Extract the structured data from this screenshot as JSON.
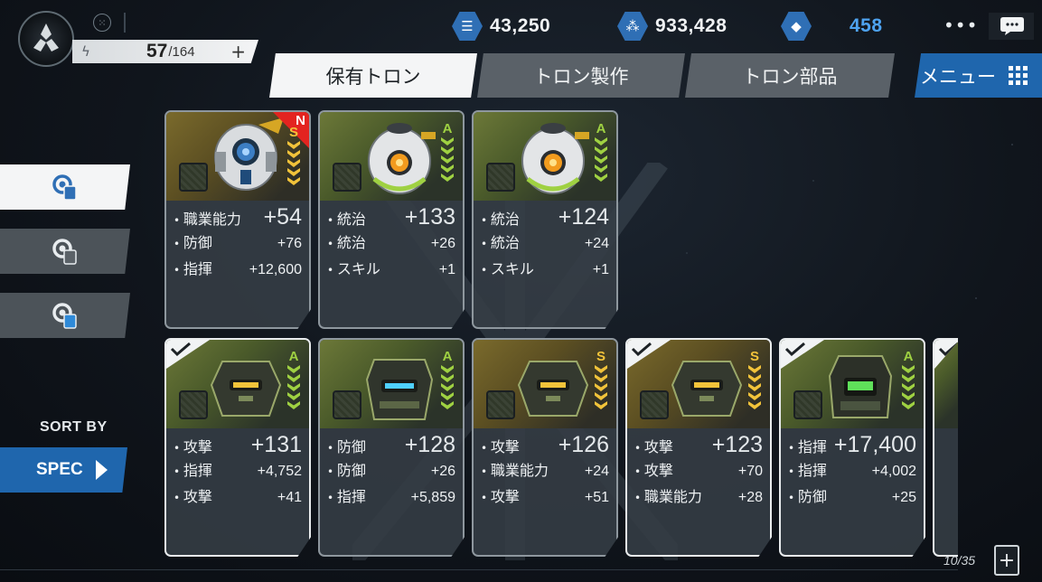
{
  "header": {
    "stamina_current": "57",
    "stamina_max": "/164",
    "stamina_plus": "+",
    "resources": [
      {
        "icon": "layers-icon",
        "value": "43,250",
        "color": "#2f6fb5"
      },
      {
        "icon": "molecule-icon",
        "value": "933,428",
        "color": "#2f6fb5"
      },
      {
        "icon": "crystal-icon",
        "value": "458",
        "color": "#4ea3f0"
      }
    ],
    "more_label": "•••"
  },
  "tabs": [
    {
      "label": "保有トロン",
      "active": true
    },
    {
      "label": "トロン製作",
      "active": false
    },
    {
      "label": "トロン部品",
      "active": false
    }
  ],
  "menu_label": "メニュー",
  "sidebar": {
    "filters": [
      {
        "icon": "tron-filter-all-icon",
        "active": true
      },
      {
        "icon": "tron-filter-gray-icon",
        "active": false
      },
      {
        "icon": "tron-filter-blue-icon",
        "active": false
      }
    ],
    "sort_by_label": "SORT BY",
    "sort_value": "SPEC"
  },
  "cards_row1": [
    {
      "rank": "S",
      "new_label": "N",
      "checked": false,
      "portrait": "white-gold",
      "stats": [
        {
          "name": "職業能力",
          "value": "+54"
        },
        {
          "name": "防御",
          "value": "+76"
        },
        {
          "name": "指揮",
          "value": "+12,600"
        }
      ]
    },
    {
      "rank": "A",
      "checked": false,
      "portrait": "white-green",
      "stats": [
        {
          "name": "統治",
          "value": "+133"
        },
        {
          "name": "統治",
          "value": "+26"
        },
        {
          "name": "スキル",
          "value": "+1"
        }
      ]
    },
    {
      "rank": "A",
      "checked": false,
      "portrait": "white-green",
      "stats": [
        {
          "name": "統治",
          "value": "+124"
        },
        {
          "name": "統治",
          "value": "+24"
        },
        {
          "name": "スキル",
          "value": "+1"
        }
      ]
    }
  ],
  "cards_row2": [
    {
      "rank": "A",
      "checked": true,
      "stats": [
        {
          "name": "攻撃",
          "value": "+131"
        },
        {
          "name": "指揮",
          "value": "+4,752"
        },
        {
          "name": "攻撃",
          "value": "+41"
        }
      ]
    },
    {
      "rank": "A",
      "checked": false,
      "stats": [
        {
          "name": "防御",
          "value": "+128"
        },
        {
          "name": "防御",
          "value": "+26"
        },
        {
          "name": "指揮",
          "value": "+5,859"
        }
      ]
    },
    {
      "rank": "S",
      "checked": false,
      "stats": [
        {
          "name": "攻撃",
          "value": "+126"
        },
        {
          "name": "職業能力",
          "value": "+24"
        },
        {
          "name": "攻撃",
          "value": "+51"
        }
      ]
    },
    {
      "rank": "S",
      "checked": true,
      "stats": [
        {
          "name": "攻撃",
          "value": "+123"
        },
        {
          "name": "攻撃",
          "value": "+70"
        },
        {
          "name": "職業能力",
          "value": "+28"
        }
      ]
    },
    {
      "rank": "A",
      "checked": true,
      "stats": [
        {
          "name": "指揮",
          "value": "+17,400"
        },
        {
          "name": "指揮",
          "value": "+4,002"
        },
        {
          "name": "防御",
          "value": "+25"
        }
      ]
    }
  ],
  "footer": {
    "counter": "10/35",
    "add_label": "+"
  }
}
